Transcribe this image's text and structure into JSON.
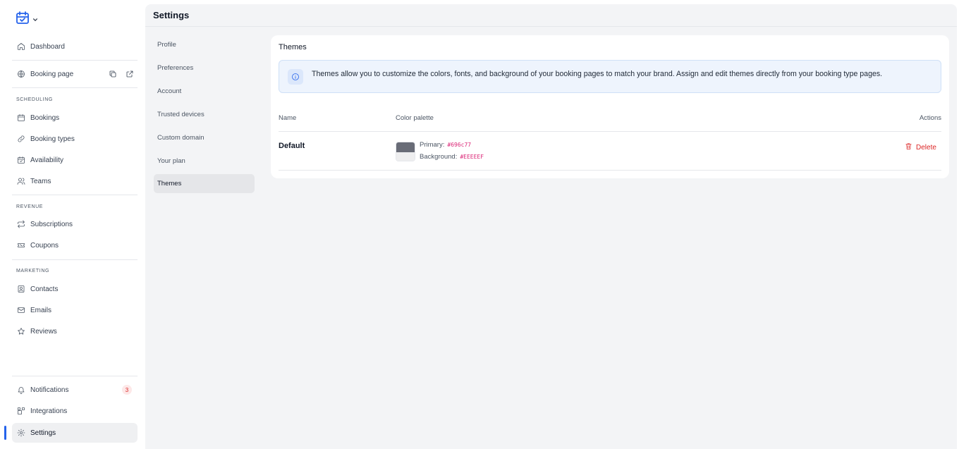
{
  "sidebar": {
    "dashboard": "Dashboard",
    "booking_page": "Booking page",
    "sections": {
      "scheduling": "SCHEDULING",
      "revenue": "REVENUE",
      "marketing": "MARKETING"
    },
    "bookings": "Bookings",
    "booking_types": "Booking types",
    "availability": "Availability",
    "teams": "Teams",
    "subscriptions": "Subscriptions",
    "coupons": "Coupons",
    "contacts": "Contacts",
    "emails": "Emails",
    "reviews": "Reviews",
    "notifications": "Notifications",
    "notifications_count": "3",
    "integrations": "Integrations",
    "settings": "Settings"
  },
  "header": {
    "title": "Settings"
  },
  "subnav": {
    "items": [
      "Profile",
      "Preferences",
      "Account",
      "Trusted devices",
      "Custom domain",
      "Your plan",
      "Themes"
    ],
    "active": "Themes"
  },
  "themes_card": {
    "title": "Themes",
    "info": "Themes allow you to customize the colors, fonts, and background of your booking pages to match your brand. Assign and edit themes directly from your booking type pages.",
    "columns": {
      "name": "Name",
      "palette": "Color palette",
      "actions": "Actions"
    },
    "rows": [
      {
        "name": "Default",
        "primary_label": "Primary:",
        "primary_value": "#696c77",
        "background_label": "Background:",
        "background_value": "#EEEEEF",
        "delete_label": "Delete"
      }
    ]
  },
  "colors": {
    "accent": "#2563eb",
    "danger": "#dc2626",
    "primary_swatch": "#696c77",
    "background_swatch": "#EEEEEF"
  }
}
